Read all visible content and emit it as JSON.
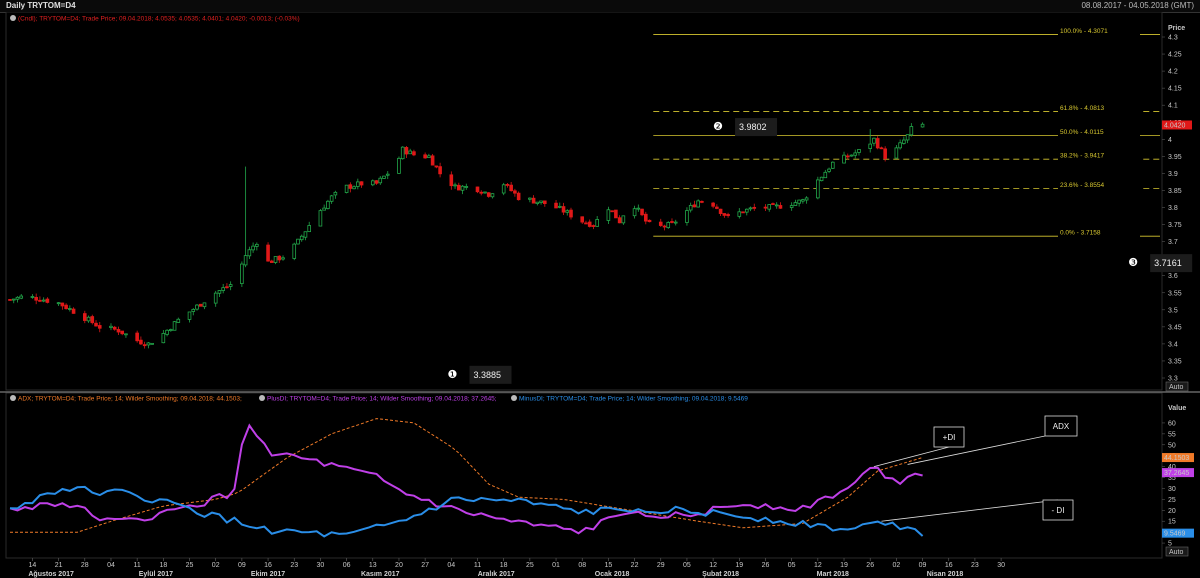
{
  "header": {
    "title": "Daily TRYTOM=D4",
    "date_range": "08.08.2017 - 04.05.2018 (GMT)"
  },
  "price_panel": {
    "legend": "(Cndl); TRYTOM=D4; Trade Price; 09.04.2018; 4.0535; 4.0535; 4.0401; 4.0420; -0.0013; (-0.03%)",
    "axis_title": "Price",
    "auto_label": "Auto",
    "current_price": "4.0420",
    "ylim": [
      3.3,
      4.3
    ]
  },
  "indicator_panel": {
    "legend_adx": "ADX; TRYTOM=D4; Trade Price;  14; Wilder Smoothing; 09.04.2018; 44.1503;",
    "legend_plus": "PlusDI; TRYTOM=D4; Trade Price;  14; Wilder Smoothing; 09.04.2018; 37.2645;",
    "legend_minus": "MinusDI; TRYTOM=D4; Trade Price;  14; Wilder Smoothing; 09.04.2018; 9.5469",
    "axis_title": "Value",
    "auto_label": "Auto",
    "adx_value": "44.1503",
    "plus_value": "37.2645",
    "minus_value": "9.5469",
    "ylim": [
      0,
      65
    ]
  },
  "annotations": [
    {
      "num": "❶",
      "value": "3.3885",
      "day": 125
    },
    {
      "num": "❷",
      "value": "3.9802",
      "day": 196
    },
    {
      "num": "❸",
      "value": "3.7161",
      "day": 307
    }
  ],
  "callouts": [
    {
      "label": "+DI"
    },
    {
      "label": "ADX"
    },
    {
      "label": "- DI"
    }
  ],
  "fib_levels": [
    {
      "label": "100.0%",
      "value": 4.3071,
      "text": "4.3071",
      "dashed": false
    },
    {
      "label": "61.8%",
      "value": 4.0813,
      "text": "4.0813",
      "dashed": true
    },
    {
      "label": "50.0%",
      "value": 4.0115,
      "text": "4.0115",
      "dashed": false
    },
    {
      "label": "38.2%",
      "value": 3.9417,
      "text": "3.9417",
      "dashed": true
    },
    {
      "label": "23.6%",
      "value": 3.8554,
      "text": "3.8554",
      "dashed": true
    },
    {
      "label": "0.0%",
      "value": 3.7158,
      "text": "3.7158",
      "dashed": false
    }
  ],
  "colors": {
    "up": "#22a84a",
    "down": "#e01818",
    "adx": "#f07a28",
    "plus_di": "#c040e8",
    "minus_di": "#2a8ee8",
    "fib": "#d8c830",
    "legend_red": "#e02020",
    "legend_orange": "#f07a28",
    "legend_purple": "#c040e8",
    "legend_blue": "#2a8ee8"
  },
  "chart_data": [
    {
      "type": "candlestick",
      "series_name": "TRYTOM=D4",
      "x_axis": "date",
      "x_start": "2017-08-08",
      "x_end": "2018-05-04",
      "yticks": [
        3.3,
        3.35,
        3.4,
        3.45,
        3.5,
        3.55,
        3.6,
        3.65,
        3.7,
        3.75,
        3.8,
        3.85,
        3.9,
        3.95,
        4.0,
        4.05,
        4.1,
        4.15,
        4.2,
        4.25,
        4.3
      ],
      "ylabel": "Price",
      "close_path": [
        {
          "x": "2017-08-08",
          "y": 3.53
        },
        {
          "x": "2017-08-12",
          "y": 3.54
        },
        {
          "x": "2017-08-17",
          "y": 3.53
        },
        {
          "x": "2017-08-21",
          "y": 3.52
        },
        {
          "x": "2017-08-26",
          "y": 3.49
        },
        {
          "x": "2017-09-01",
          "y": 3.45
        },
        {
          "x": "2017-09-06",
          "y": 3.44
        },
        {
          "x": "2017-09-11",
          "y": 3.41
        },
        {
          "x": "2017-09-14",
          "y": 3.4
        },
        {
          "x": "2017-09-18",
          "y": 3.43
        },
        {
          "x": "2017-09-22",
          "y": 3.47
        },
        {
          "x": "2017-09-27",
          "y": 3.51
        },
        {
          "x": "2017-10-02",
          "y": 3.55
        },
        {
          "x": "2017-10-07",
          "y": 3.58
        },
        {
          "x": "2017-10-10",
          "y": 3.66
        },
        {
          "x": "2017-10-13",
          "y": 3.7
        },
        {
          "x": "2017-10-16",
          "y": 3.64
        },
        {
          "x": "2017-10-21",
          "y": 3.66
        },
        {
          "x": "2017-10-24",
          "y": 3.7
        },
        {
          "x": "2017-10-29",
          "y": 3.78
        },
        {
          "x": "2017-11-02",
          "y": 3.83
        },
        {
          "x": "2017-11-06",
          "y": 3.86
        },
        {
          "x": "2017-11-10",
          "y": 3.87
        },
        {
          "x": "2017-11-14",
          "y": 3.87
        },
        {
          "x": "2017-11-19",
          "y": 3.92
        },
        {
          "x": "2017-11-21",
          "y": 3.97
        },
        {
          "x": "2017-11-25",
          "y": 3.95
        },
        {
          "x": "2017-11-28",
          "y": 3.95
        },
        {
          "x": "2017-12-01",
          "y": 3.9
        },
        {
          "x": "2017-12-05",
          "y": 3.86
        },
        {
          "x": "2017-12-10",
          "y": 3.86
        },
        {
          "x": "2017-12-14",
          "y": 3.84
        },
        {
          "x": "2017-12-18",
          "y": 3.87
        },
        {
          "x": "2017-12-22",
          "y": 3.83
        },
        {
          "x": "2017-12-26",
          "y": 3.82
        },
        {
          "x": "2017-12-30",
          "y": 3.81
        },
        {
          "x": "2018-01-03",
          "y": 3.79
        },
        {
          "x": "2018-01-08",
          "y": 3.76
        },
        {
          "x": "2018-01-11",
          "y": 3.75
        },
        {
          "x": "2018-01-15",
          "y": 3.8
        },
        {
          "x": "2018-01-18",
          "y": 3.76
        },
        {
          "x": "2018-01-21",
          "y": 3.82
        },
        {
          "x": "2018-01-25",
          "y": 3.76
        },
        {
          "x": "2018-01-27",
          "y": 3.74
        },
        {
          "x": "2018-02-01",
          "y": 3.75
        },
        {
          "x": "2018-02-04",
          "y": 3.78
        },
        {
          "x": "2018-02-08",
          "y": 3.82
        },
        {
          "x": "2018-02-12",
          "y": 3.81
        },
        {
          "x": "2018-02-16",
          "y": 3.77
        },
        {
          "x": "2018-02-20",
          "y": 3.79
        },
        {
          "x": "2018-02-24",
          "y": 3.8
        },
        {
          "x": "2018-02-28",
          "y": 3.8
        },
        {
          "x": "2018-03-04",
          "y": 3.81
        },
        {
          "x": "2018-03-08",
          "y": 3.82
        },
        {
          "x": "2018-03-12",
          "y": 3.88
        },
        {
          "x": "2018-03-16",
          "y": 3.93
        },
        {
          "x": "2018-03-20",
          "y": 3.95
        },
        {
          "x": "2018-03-24",
          "y": 3.97
        },
        {
          "x": "2018-03-27",
          "y": 4.0
        },
        {
          "x": "2018-03-30",
          "y": 3.95
        },
        {
          "x": "2018-04-02",
          "y": 3.97
        },
        {
          "x": "2018-04-05",
          "y": 4.01
        },
        {
          "x": "2018-04-07",
          "y": 4.05
        },
        {
          "x": "2018-04-09",
          "y": 4.042
        }
      ]
    },
    {
      "type": "line",
      "x_axis": "date",
      "ylabel": "Value",
      "ylim": [
        0,
        65
      ],
      "yticks": [
        5,
        10,
        15,
        20,
        25,
        30,
        35,
        40,
        45,
        50,
        55,
        60
      ],
      "series": [
        {
          "name": "ADX",
          "style": "dashed",
          "points": [
            {
              "x": "2017-08-08",
              "y": 10
            },
            {
              "x": "2017-08-26",
              "y": 10
            },
            {
              "x": "2017-09-06",
              "y": 16
            },
            {
              "x": "2017-09-18",
              "y": 22
            },
            {
              "x": "2017-10-02",
              "y": 25
            },
            {
              "x": "2017-10-08",
              "y": 28
            },
            {
              "x": "2017-10-21",
              "y": 44
            },
            {
              "x": "2017-11-02",
              "y": 55
            },
            {
              "x": "2017-11-14",
              "y": 62
            },
            {
              "x": "2017-11-24",
              "y": 60
            },
            {
              "x": "2017-12-05",
              "y": 48
            },
            {
              "x": "2017-12-14",
              "y": 32
            },
            {
              "x": "2017-12-22",
              "y": 26
            },
            {
              "x": "2018-01-03",
              "y": 25
            },
            {
              "x": "2018-01-21",
              "y": 20
            },
            {
              "x": "2018-02-08",
              "y": 15
            },
            {
              "x": "2018-02-20",
              "y": 12
            },
            {
              "x": "2018-03-08",
              "y": 14
            },
            {
              "x": "2018-03-20",
              "y": 26
            },
            {
              "x": "2018-03-28",
              "y": 38
            },
            {
              "x": "2018-04-09",
              "y": 44.15
            }
          ]
        },
        {
          "name": "+DI",
          "style": "solid",
          "points": [
            {
              "x": "2017-08-08",
              "y": 20
            },
            {
              "x": "2017-08-21",
              "y": 24
            },
            {
              "x": "2017-09-06",
              "y": 14
            },
            {
              "x": "2017-09-22",
              "y": 20
            },
            {
              "x": "2017-10-07",
              "y": 28
            },
            {
              "x": "2017-10-10",
              "y": 62
            },
            {
              "x": "2017-10-16",
              "y": 47
            },
            {
              "x": "2017-10-29",
              "y": 42
            },
            {
              "x": "2017-11-14",
              "y": 35
            },
            {
              "x": "2017-11-21",
              "y": 28
            },
            {
              "x": "2017-12-05",
              "y": 20
            },
            {
              "x": "2017-12-22",
              "y": 14
            },
            {
              "x": "2018-01-08",
              "y": 10
            },
            {
              "x": "2018-01-21",
              "y": 20
            },
            {
              "x": "2018-02-04",
              "y": 17
            },
            {
              "x": "2018-02-20",
              "y": 23
            },
            {
              "x": "2018-03-08",
              "y": 21
            },
            {
              "x": "2018-03-20",
              "y": 30
            },
            {
              "x": "2018-03-27",
              "y": 40
            },
            {
              "x": "2018-04-02",
              "y": 33
            },
            {
              "x": "2018-04-09",
              "y": 37.26
            }
          ]
        },
        {
          "name": "-DI",
          "style": "solid",
          "points": [
            {
              "x": "2017-08-08",
              "y": 20
            },
            {
              "x": "2017-08-21",
              "y": 30
            },
            {
              "x": "2017-09-06",
              "y": 28
            },
            {
              "x": "2017-09-18",
              "y": 24
            },
            {
              "x": "2017-10-02",
              "y": 17
            },
            {
              "x": "2017-10-16",
              "y": 11
            },
            {
              "x": "2017-11-06",
              "y": 8
            },
            {
              "x": "2017-11-21",
              "y": 15
            },
            {
              "x": "2017-12-05",
              "y": 25
            },
            {
              "x": "2017-12-22",
              "y": 24
            },
            {
              "x": "2018-01-08",
              "y": 19
            },
            {
              "x": "2018-01-25",
              "y": 21
            },
            {
              "x": "2018-02-16",
              "y": 18
            },
            {
              "x": "2018-03-04",
              "y": 15
            },
            {
              "x": "2018-03-20",
              "y": 11
            },
            {
              "x": "2018-03-30",
              "y": 15
            },
            {
              "x": "2018-04-09",
              "y": 9.55
            }
          ]
        }
      ]
    }
  ],
  "x_axis": {
    "day_ticks": [
      {
        "date": "2017-08-14",
        "label": "14"
      },
      {
        "date": "2017-08-21",
        "label": "21"
      },
      {
        "date": "2017-08-28",
        "label": "28"
      },
      {
        "date": "2017-09-04",
        "label": "04"
      },
      {
        "date": "2017-09-11",
        "label": "11"
      },
      {
        "date": "2017-09-18",
        "label": "18"
      },
      {
        "date": "2017-09-25",
        "label": "25"
      },
      {
        "date": "2017-10-02",
        "label": "02"
      },
      {
        "date": "2017-10-09",
        "label": "09"
      },
      {
        "date": "2017-10-16",
        "label": "16"
      },
      {
        "date": "2017-10-23",
        "label": "23"
      },
      {
        "date": "2017-10-30",
        "label": "30"
      },
      {
        "date": "2017-11-06",
        "label": "06"
      },
      {
        "date": "2017-11-13",
        "label": "13"
      },
      {
        "date": "2017-11-20",
        "label": "20"
      },
      {
        "date": "2017-11-27",
        "label": "27"
      },
      {
        "date": "2017-12-04",
        "label": "04"
      },
      {
        "date": "2017-12-11",
        "label": "11"
      },
      {
        "date": "2017-12-18",
        "label": "18"
      },
      {
        "date": "2017-12-25",
        "label": "25"
      },
      {
        "date": "2018-01-01",
        "label": "01"
      },
      {
        "date": "2018-01-08",
        "label": "08"
      },
      {
        "date": "2018-01-15",
        "label": "15"
      },
      {
        "date": "2018-01-22",
        "label": "22"
      },
      {
        "date": "2018-01-29",
        "label": "29"
      },
      {
        "date": "2018-02-05",
        "label": "05"
      },
      {
        "date": "2018-02-12",
        "label": "12"
      },
      {
        "date": "2018-02-19",
        "label": "19"
      },
      {
        "date": "2018-02-26",
        "label": "26"
      },
      {
        "date": "2018-03-05",
        "label": "05"
      },
      {
        "date": "2018-03-12",
        "label": "12"
      },
      {
        "date": "2018-03-19",
        "label": "19"
      },
      {
        "date": "2018-03-26",
        "label": "26"
      },
      {
        "date": "2018-04-02",
        "label": "02"
      },
      {
        "date": "2018-04-09",
        "label": "09"
      },
      {
        "date": "2018-04-16",
        "label": "16"
      },
      {
        "date": "2018-04-23",
        "label": "23"
      },
      {
        "date": "2018-04-30",
        "label": "30"
      }
    ],
    "months": [
      {
        "date": "2017-08-19",
        "label": "Ağustos 2017"
      },
      {
        "date": "2017-09-16",
        "label": "Eylül 2017"
      },
      {
        "date": "2017-10-16",
        "label": "Ekim 2017"
      },
      {
        "date": "2017-11-15",
        "label": "Kasım 2017"
      },
      {
        "date": "2017-12-16",
        "label": "Aralık 2017"
      },
      {
        "date": "2018-01-16",
        "label": "Ocak 2018"
      },
      {
        "date": "2018-02-14",
        "label": "Şubat 2018"
      },
      {
        "date": "2018-03-16",
        "label": "Mart 2018"
      },
      {
        "date": "2018-04-15",
        "label": "Nisan 2018"
      }
    ]
  }
}
